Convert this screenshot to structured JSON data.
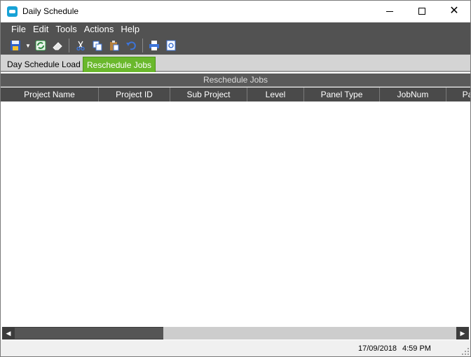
{
  "window": {
    "title": "Daily Schedule"
  },
  "menu": [
    "File",
    "Edit",
    "Tools",
    "Actions",
    "Help"
  ],
  "toolbar": {
    "icons": [
      "save-icon",
      "refresh-icon",
      "eraser-icon",
      "cut-icon",
      "copy-icon",
      "paste-icon",
      "undo-icon",
      "print-icon",
      "print-preview-icon"
    ]
  },
  "tabs": [
    {
      "label": "Day Schedule Load",
      "active": false
    },
    {
      "label": "Reschedule Jobs",
      "active": true
    }
  ],
  "grid": {
    "caption": "Reschedule Jobs",
    "columns": [
      "Project Name",
      "Project ID",
      "Sub Project",
      "Level",
      "Panel Type",
      "JobNum",
      "Pa"
    ],
    "rows": []
  },
  "status": {
    "date": "17/09/2018",
    "time": "4:59 PM"
  },
  "colors": {
    "active_tab": "#6ab82c",
    "menu_bg": "#525252",
    "header_bg": "#4a4a4a"
  }
}
